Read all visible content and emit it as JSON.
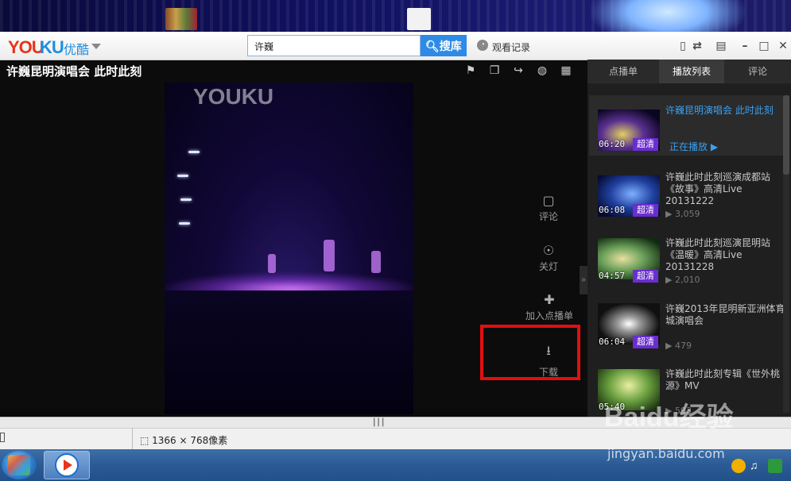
{
  "app": {
    "logo_you": "YOU",
    "logo_ku": "KU",
    "logo_cn": "优酷"
  },
  "search": {
    "value": "许巍",
    "button_label": "搜库",
    "history_label": "观看记录"
  },
  "video": {
    "title": "许巍昆明演唱会 此时此刻",
    "watermark": "YOUKU"
  },
  "side_actions": [
    {
      "label": "评论",
      "icon": "comment-icon"
    },
    {
      "label": "关灯",
      "icon": "bulb-icon"
    },
    {
      "label": "加入点播单",
      "icon": "plus-icon"
    },
    {
      "label": "下载",
      "icon": "download-icon"
    }
  ],
  "tabs": [
    {
      "label": "点播单",
      "active": false
    },
    {
      "label": "播放列表",
      "active": true
    },
    {
      "label": "评论",
      "active": false
    }
  ],
  "playlist": [
    {
      "title": "许巍昆明演唱会 此时此刻",
      "duration": "06:20",
      "quality": "超清",
      "status": "正在播放",
      "current": true
    },
    {
      "title": "许巍此时此刻巡演成都站《故事》高清Live 20131222",
      "duration": "06:08",
      "quality": "超清",
      "views": "3,059"
    },
    {
      "title": "许巍此时此刻巡演昆明站《温暖》高清Live 20131228",
      "duration": "04:57",
      "quality": "超清",
      "views": "2,010"
    },
    {
      "title": "许巍2013年昆明新亚洲体育城演唱会",
      "duration": "06:04",
      "quality": "超清",
      "views": "479"
    },
    {
      "title": "许巍此时此刻专辑《世外桃源》MV",
      "duration": "05:40",
      "quality": "",
      "views": "593"
    }
  ],
  "statusbar": {
    "dimensions": "1366 × 768像素"
  },
  "watermark": {
    "baidu": "Baidu经验",
    "url": "jingyan.baidu.com"
  },
  "colors": {
    "accent": "#2f8ae6",
    "highlight_box": "#e10f0f",
    "hd_badge": "#6a2dd0",
    "logo_red": "#e8341c",
    "logo_blue": "#1e8fe0"
  }
}
